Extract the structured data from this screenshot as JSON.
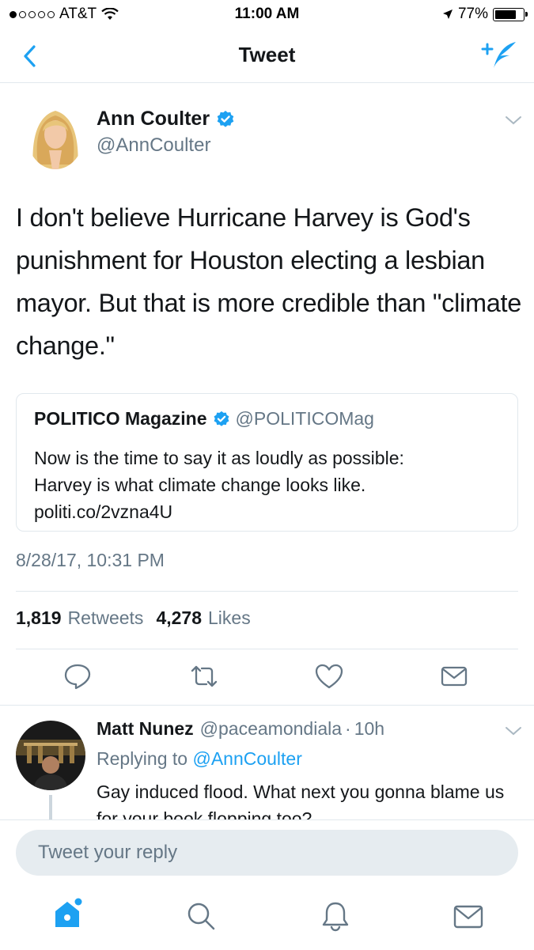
{
  "status_bar": {
    "carrier": "AT&T",
    "time": "11:00 AM",
    "battery": "77%",
    "battery_level": 0.77
  },
  "nav": {
    "title": "Tweet",
    "back_icon": "chevron-left-icon",
    "compose_icon": "compose-tweet-icon"
  },
  "tweet": {
    "author_name": "Ann Coulter",
    "author_handle": "@AnnCoulter",
    "text": "I don't believe Hurricane Harvey is God's punishment for Houston electing a lesbian mayor. But that is more credible than \"climate change.\"",
    "timestamp": "8/28/17, 10:31 PM",
    "retweets_count": "1,819",
    "retweets_label": "Retweets",
    "likes_count": "4,278",
    "likes_label": "Likes"
  },
  "quote": {
    "name": "POLITICO Magazine",
    "handle": "@POLITICOMag",
    "text_line1": "Now is the time to say it as loudly as possible:",
    "text_line2": "Harvey is what climate change looks like.",
    "text_line3": "politi.co/2vzna4U"
  },
  "reply": {
    "name": "Matt Nunez",
    "handle": "@paceamondiala",
    "dot": "·",
    "time": "10h",
    "replying_prefix": "Replying to",
    "replying_to": "@AnnCoulter",
    "text": "Gay induced flood. What next you gonna blame us for your book flopping too?"
  },
  "composer": {
    "placeholder": "Tweet your reply"
  },
  "colors": {
    "brand_blue": "#1da1f2",
    "secondary_text": "#657786",
    "divider": "#e1e8ed"
  }
}
